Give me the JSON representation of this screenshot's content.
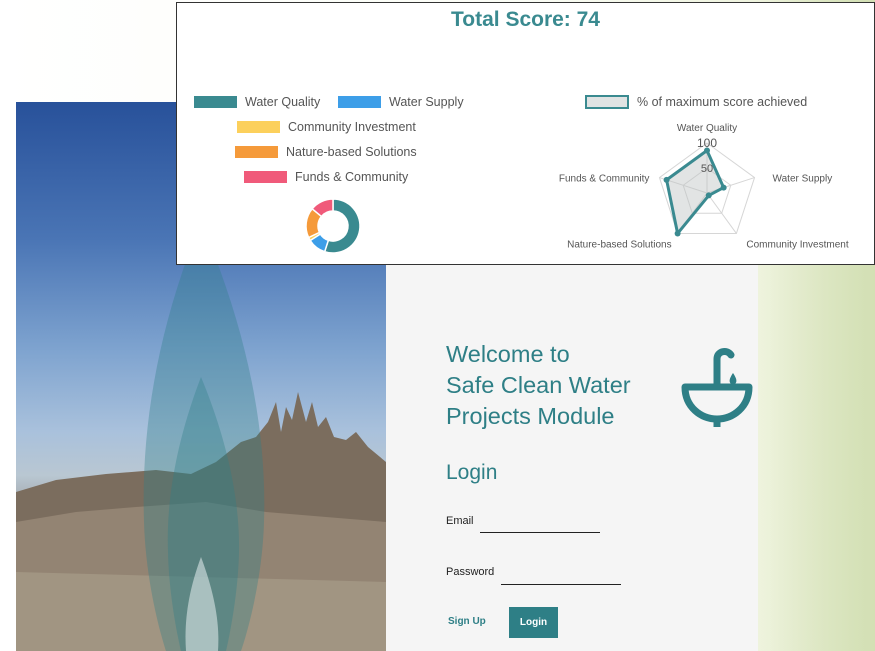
{
  "score_card": {
    "title": "Total Score: 74",
    "legend": [
      {
        "label": "Water Quality",
        "color": "#3a8a90"
      },
      {
        "label": "Water Supply",
        "color": "#3d9ee8"
      },
      {
        "label": "Community Investment",
        "color": "#fcd05c"
      },
      {
        "label": "Nature-based Solutions",
        "color": "#f59a3a"
      },
      {
        "label": "Funds & Community",
        "color": "#f05a7a"
      }
    ],
    "radar_legend_label": "% of maximum score achieved",
    "radar_axes": [
      "Water Quality",
      "Water Supply",
      "Community Investment",
      "Nature-based Solutions",
      "Funds & Community"
    ],
    "radar_ticks": [
      "100",
      "50"
    ]
  },
  "chart_data": [
    {
      "type": "pie",
      "variant": "doughnut",
      "categories": [
        "Water Quality",
        "Water Supply",
        "Community Investment",
        "Nature-based Solutions",
        "Funds & Community"
      ],
      "values": [
        55,
        11,
        2,
        18,
        14
      ],
      "colors": [
        "#3a8a90",
        "#3d9ee8",
        "#fcd05c",
        "#f59a3a",
        "#f05a7a"
      ]
    },
    {
      "type": "radar",
      "categories": [
        "Water Quality",
        "Water Supply",
        "Community Investment",
        "Nature-based Solutions",
        "Funds & Community"
      ],
      "series": [
        {
          "name": "% of maximum score achieved",
          "values": [
            85,
            35,
            6,
            100,
            85
          ]
        }
      ],
      "range": [
        0,
        100
      ],
      "ticks": [
        50,
        100
      ]
    }
  ],
  "login_page": {
    "welcome_lines": [
      "Welcome to",
      "Safe Clean Water",
      "Projects Module"
    ],
    "login_heading": "Login",
    "email_label": "Email",
    "email_value": "",
    "password_label": "Password",
    "password_value": "",
    "signup_label": "Sign Up",
    "login_button_label": "Login",
    "accent_color": "#2e7f86"
  },
  "icons": {
    "logo": "umbrella-water-drop-icon"
  }
}
